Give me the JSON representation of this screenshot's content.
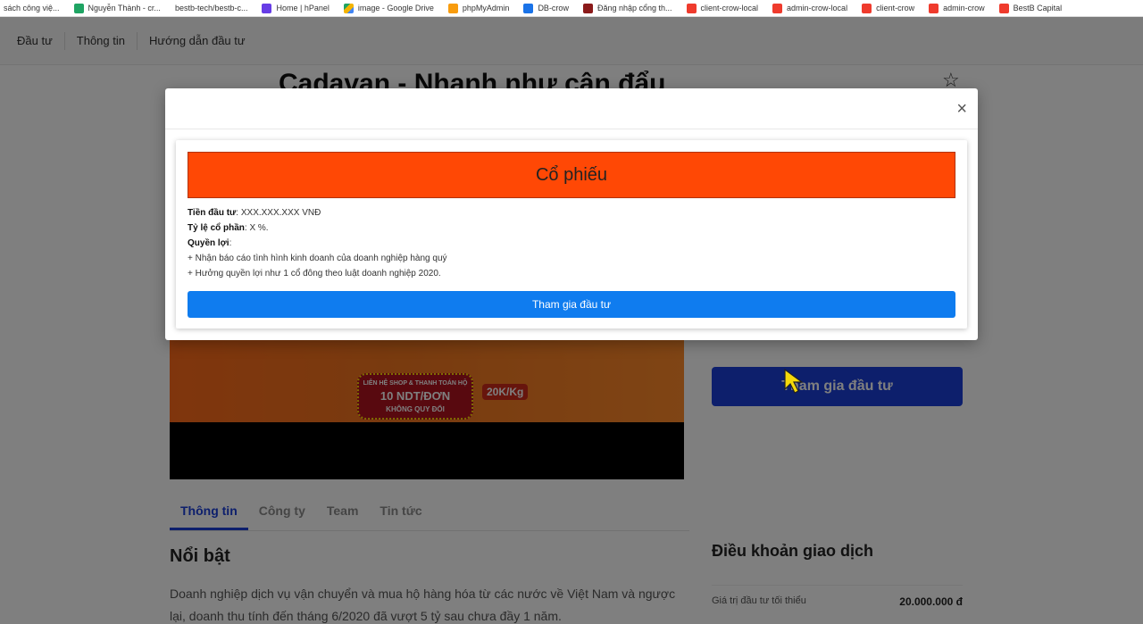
{
  "bookmarks": [
    {
      "label": "sách công việ...",
      "icon": "bookmark-icon",
      "color": "#ffffff"
    },
    {
      "label": "Nguyễn Thành - cr...",
      "icon": "sheets-icon",
      "color": "#1fa463"
    },
    {
      "label": "bestb-tech/bestb-c...",
      "icon": "github-icon",
      "color": "#222222"
    },
    {
      "label": "Home | hPanel",
      "icon": "hpanel-icon",
      "color": "#673de6"
    },
    {
      "label": "image - Google Drive",
      "icon": "drive-icon",
      "color": "#f4b400"
    },
    {
      "label": "phpMyAdmin",
      "icon": "phpmyadmin-icon",
      "color": "#f89c0e"
    },
    {
      "label": "DB-crow",
      "icon": "db-icon",
      "color": "#1a73e8"
    },
    {
      "label": "Đăng nhập cổng th...",
      "icon": "portal-icon",
      "color": "#8b1a1a"
    },
    {
      "label": "client-crow-local",
      "icon": "laravel-icon",
      "color": "#ef3b2d"
    },
    {
      "label": "admin-crow-local",
      "icon": "laravel-icon",
      "color": "#ef3b2d"
    },
    {
      "label": "client-crow",
      "icon": "laravel-icon",
      "color": "#ef3b2d"
    },
    {
      "label": "admin-crow",
      "icon": "laravel-icon",
      "color": "#ef3b2d"
    },
    {
      "label": "BestB Capital",
      "icon": "laravel-icon",
      "color": "#ef3b2d"
    }
  ],
  "nav": {
    "items": [
      "Đầu tư",
      "Thông tin",
      "Hướng dẫn đầu tư"
    ]
  },
  "page": {
    "title": "Cadavan - Nhanh như cận đẩu",
    "invest_button": "Tham gia đầu tư",
    "hero": {
      "badge_line1": "LIÊN HỆ SHOP & THANH TOÁN HỘ",
      "badge_line2": "10 NDT/ĐƠN",
      "badge_line3": "KHÔNG QUY ĐỔI",
      "price": "20K/Kg"
    },
    "tabs": [
      {
        "label": "Thông tin",
        "active": true
      },
      {
        "label": "Công ty",
        "active": false
      },
      {
        "label": "Team",
        "active": false
      },
      {
        "label": "Tin tức",
        "active": false
      }
    ],
    "highlight_title": "Nổi bật",
    "highlight_text": "Doanh nghiệp dịch vụ vận chuyển và mua hộ hàng hóa từ các nước về Việt Nam và ngược lại, doanh thu tính đến tháng 6/2020 đã vượt 5 tỷ sau chưa đầy 1 năm.",
    "terms_title": "Điều khoản giao dịch",
    "terms_min_label": "Giá trị đầu tư tối thiểu",
    "terms_min_value": "20.000.000 đ"
  },
  "modal": {
    "close": "×",
    "banner": "Cổ phiếu",
    "amount_label": "Tiền đầu tư",
    "amount_value": ": XXX.XXX.XXX VNĐ",
    "share_label": "Tỷ lệ cổ phần",
    "share_value": ": X %.",
    "rights_label": "Quyền lợi",
    "rights_colon": ":",
    "rights": [
      "+ Nhận báo cáo tình hình kinh doanh của doanh nghiệp hàng quý",
      "+ Hưởng quyền lợi như 1 cổ đông theo luật doanh nghiệp 2020."
    ],
    "button": "Tham gia đầu tư",
    "banner_color": "#ff4805",
    "button_color": "#0f7cef"
  }
}
